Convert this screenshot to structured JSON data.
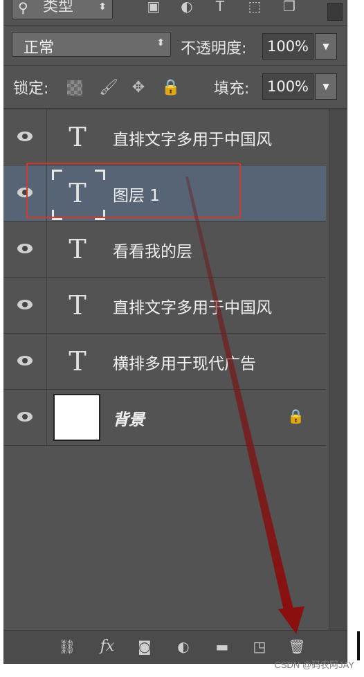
{
  "filter": {
    "kind_label": "类型",
    "icons": [
      "image-filter-icon",
      "adjustment-filter-icon",
      "text-filter-icon",
      "shape-filter-icon",
      "smart-object-filter-icon"
    ]
  },
  "blend": {
    "mode": "正常",
    "opacity_label": "不透明度:",
    "opacity_value": "100%"
  },
  "lock": {
    "label": "锁定:",
    "fill_label": "填充:",
    "fill_value": "100%"
  },
  "layers": [
    {
      "name": "直排文字多用于中国风",
      "type": "text"
    },
    {
      "name": "图层 1",
      "type": "text",
      "selected": true
    },
    {
      "name": "看看我的层",
      "type": "text"
    },
    {
      "name": "直排文字多用于中国风",
      "type": "text"
    },
    {
      "name": "横排多用于现代广告",
      "type": "text"
    },
    {
      "name": "背景",
      "type": "background",
      "locked": true
    }
  ],
  "toolbar": {
    "icons": [
      "link-layers-icon",
      "fx-icon",
      "add-mask-icon",
      "adjustment-layer-icon",
      "new-group-icon",
      "new-layer-icon",
      "delete-layer-icon"
    ],
    "fx_label": "fx"
  },
  "colors": {
    "panel_bg": "#535353",
    "selected_bg": "#576476",
    "annotation_red": "#d23a2a",
    "arrow_red": "#8b0f0f"
  },
  "watermark": "CSDN @码农阿JAY"
}
